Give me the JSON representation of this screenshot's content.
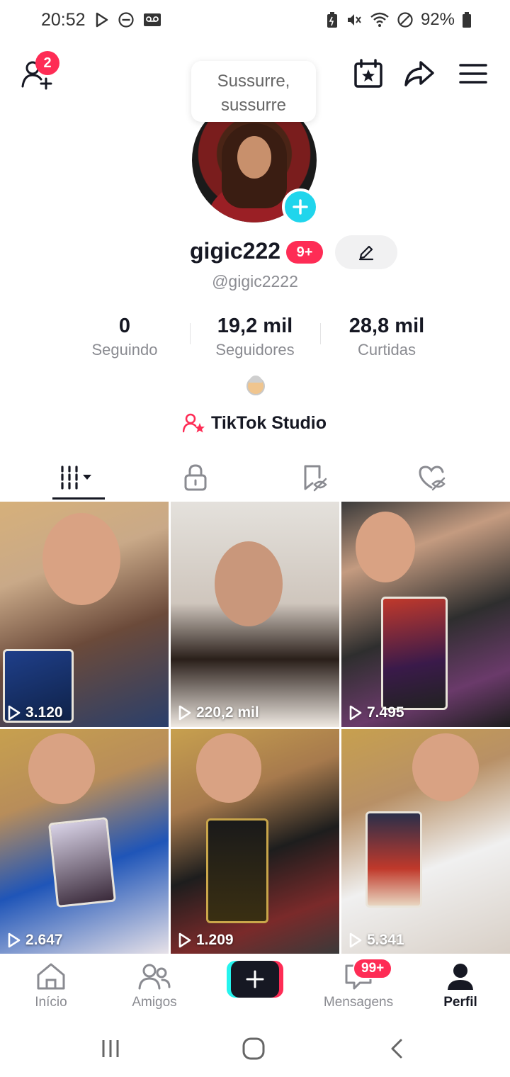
{
  "status_bar": {
    "time": "20:52",
    "battery_percent": "92%"
  },
  "top_bar": {
    "add_friend_badge": "2",
    "icons": [
      "add-friend-icon",
      "calendar-star-icon",
      "share-icon",
      "menu-icon"
    ]
  },
  "tooltip": {
    "text_line1": "Sussurre,",
    "text_line2": "sussurre"
  },
  "profile": {
    "username": "gigic222",
    "badge": "9+",
    "handle": "@gigic2222"
  },
  "stats": [
    {
      "value": "0",
      "label": "Seguindo"
    },
    {
      "value": "19,2 mil",
      "label": "Seguidores"
    },
    {
      "value": "28,8 mil",
      "label": "Curtidas"
    }
  ],
  "studio": {
    "label": "TikTok Studio"
  },
  "tabs": [
    "videos-grid-icon",
    "lock-icon",
    "bookmark-hidden-icon",
    "liked-hidden-icon"
  ],
  "videos": [
    {
      "views": "3.120"
    },
    {
      "views": "220,2 mil"
    },
    {
      "views": "7.495"
    },
    {
      "views": "2.647"
    },
    {
      "views": "1.209"
    },
    {
      "views": "5.341"
    }
  ],
  "bottom_nav": {
    "home": "Início",
    "friends": "Amigos",
    "messages": "Mensagens",
    "messages_badge": "99+",
    "profile": "Perfil"
  },
  "colors": {
    "accent_red": "#fe2c55",
    "accent_cyan": "#20d5ec",
    "text_primary": "#161823",
    "text_secondary": "#8a8b91"
  }
}
